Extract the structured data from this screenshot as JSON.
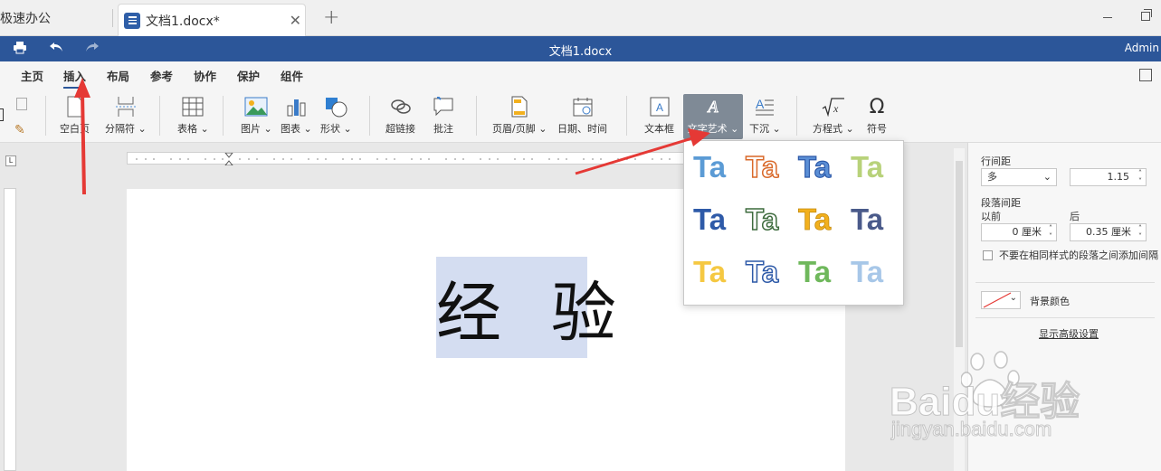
{
  "tabs": {
    "inactive_label": "极速办公",
    "active_label": "文档1.docx*",
    "add_label": "+",
    "close_label": "✕"
  },
  "titlebar": {
    "title": "文档1.docx",
    "user": "Admin"
  },
  "menu": [
    "主页",
    "插入",
    "布局",
    "参考",
    "协作",
    "保护",
    "组件"
  ],
  "active_menu": "插入",
  "ribbon": {
    "blank_page": "空白页",
    "page_break": "分隔符",
    "table": "表格",
    "image": "图片",
    "chart": "图表",
    "shape": "形状",
    "hyperlink": "超链接",
    "comment": "批注",
    "header_footer": "页眉/页脚",
    "datetime": "日期、时间",
    "textbox": "文本框",
    "wordart": "文字艺术",
    "dropcap": "下沉",
    "equation": "方程式",
    "symbol": "符号"
  },
  "document": {
    "text": "经 验"
  },
  "wordart_popup": {
    "sample": "Ta"
  },
  "panel": {
    "line_spacing_label": "行间距",
    "line_spacing_mode": "多",
    "line_spacing_value": "1.15",
    "paragraph_spacing_label": "段落间距",
    "before_label": "以前",
    "after_label": "后",
    "before_value": "0 厘米",
    "after_value": "0.35 厘米",
    "no_space_checkbox_label": "不要在相同样式的段落之间添加间隔",
    "background_color_label": "背景颜色",
    "advanced_link": "显示高级设置"
  },
  "watermark": {
    "brand": "Baidu经验",
    "url": "jingyan.baidu.com"
  },
  "colors": {
    "accent": "#2c5699",
    "selection": "#d4ddf1",
    "arrow": "#e53935"
  }
}
